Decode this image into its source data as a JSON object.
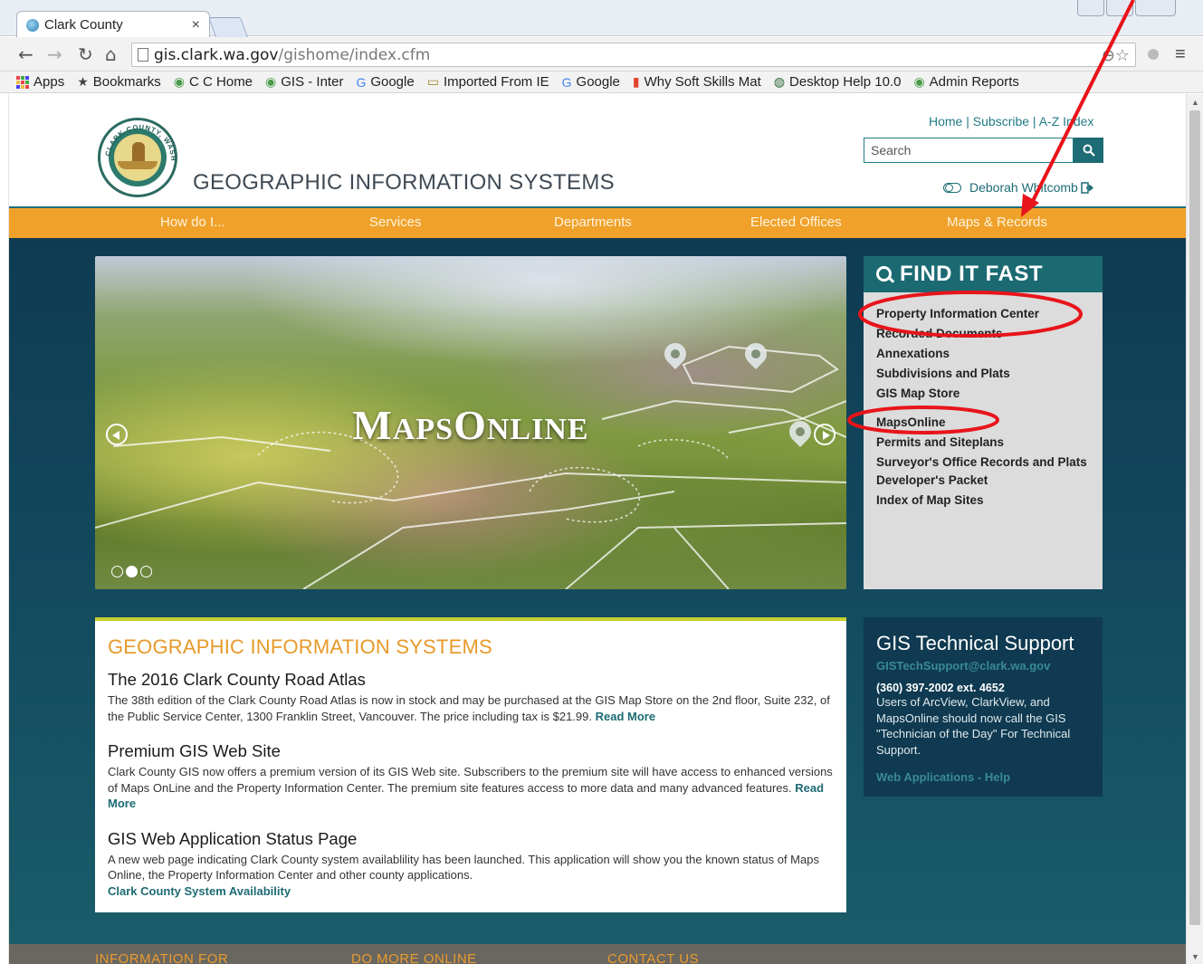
{
  "browser": {
    "tab_title": "Clark County",
    "tab_close": "×",
    "url_host": "gis.clark.wa.gov",
    "url_path": "/gishome/index.cfm",
    "bookmarks": [
      {
        "label": "Apps",
        "icon": "apps-grid-icon"
      },
      {
        "label": "Bookmarks",
        "icon": "star-icon"
      },
      {
        "label": "C C Home",
        "icon": "county-seal-icon"
      },
      {
        "label": "GIS - Inter",
        "icon": "county-seal-icon"
      },
      {
        "label": "Google",
        "icon": "google-g-icon"
      },
      {
        "label": "Imported From IE",
        "icon": "folder-icon"
      },
      {
        "label": "Google",
        "icon": "google-g-icon"
      },
      {
        "label": "Why Soft Skills Mat",
        "icon": "chart-icon"
      },
      {
        "label": "Desktop Help 10.0",
        "icon": "globe-icon"
      },
      {
        "label": "Admin Reports",
        "icon": "county-seal-icon"
      }
    ]
  },
  "header": {
    "site_title": "GEOGRAPHIC INFORMATION SYSTEMS",
    "top_links": [
      "Home",
      "Subscribe",
      "A-Z Index"
    ],
    "search_placeholder": "Search",
    "user_name": "Deborah Whitcomb",
    "seal_text": "CLARK COUNTY, WASHINGTON"
  },
  "nav": {
    "items": [
      "How do I...",
      "Services",
      "Departments",
      "Elected Offices",
      "Maps & Records"
    ]
  },
  "carousel": {
    "logo_text": "MapsOnline",
    "active_slide": 2,
    "slide_count": 3
  },
  "find_it_fast": {
    "title": "FIND IT FAST",
    "links": [
      "Property Information Center",
      "Recorded Documents",
      "Annexations",
      "Subdivisions and Plats",
      "GIS Map Store",
      "MapsOnline",
      "Permits and Siteplans",
      "Surveyor's Office Records and Plats",
      "Developer's Packet",
      "Index of Map Sites"
    ]
  },
  "content": {
    "heading": "GEOGRAPHIC INFORMATION SYSTEMS",
    "articles": [
      {
        "title": "The 2016 Clark County Road Atlas",
        "body": "The 38th edition of the Clark County Road Atlas is now in stock and may be purchased at the GIS Map Store on the 2nd floor, Suite 232, of the Public Service Center, 1300 Franklin Street, Vancouver. The price including tax is $21.99.",
        "link": "Read More"
      },
      {
        "title": "Premium GIS Web Site",
        "body": "Clark County GIS now offers a premium version of its GIS Web site. Subscribers to the premium site will have access to enhanced versions of Maps OnLine and the Property Information Center. The premium site features access to more data and many advanced features.",
        "link": "Read More"
      },
      {
        "title": "GIS Web Application Status Page",
        "body": "A new web page indicating Clark County system availablility has been launched. This application will show you the known status of Maps Online, the Property Information Center and other county applications.",
        "link": "Clark County System Availability"
      }
    ]
  },
  "support": {
    "title": "GIS Technical Support",
    "email": "GISTechSupport@clark.wa.gov",
    "phone": "(360) 397-2002 ext. 4652",
    "description": "Users of ArcView, ClarkView, and MapsOnline should now call the GIS \"Technician of the Day\" For Technical Support.",
    "help_link": "Web Applications - Help"
  },
  "footer": {
    "sections": [
      "INFORMATION FOR",
      "DO MORE ONLINE",
      "CONTACT US"
    ]
  },
  "colors": {
    "nav_orange": "#f0a12a",
    "teal": "#1b6a72",
    "annotation_red": "#e8141b"
  }
}
